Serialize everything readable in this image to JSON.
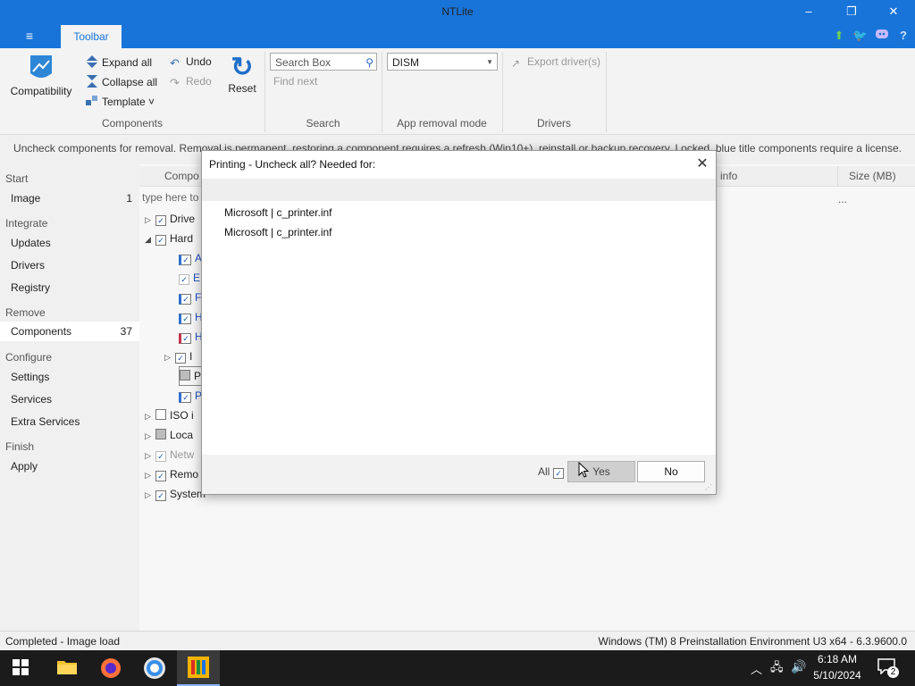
{
  "window": {
    "title": "NTLite",
    "menu_icon": "hamburger-menu-icon",
    "tab": "Toolbar",
    "minimize": "–",
    "restore": "❐",
    "close": "✕"
  },
  "ribbon": {
    "compatibility": "Compatibility",
    "expand_all": "Expand all",
    "collapse_all": "Collapse all",
    "template": "Template ˅",
    "undo": "Undo",
    "redo": "Redo",
    "reset": "Reset",
    "search_placeholder": "Search Box",
    "find_next": "Find next",
    "dism_value": "DISM",
    "export_drivers": "Export driver(s)",
    "groups": {
      "components": "Components",
      "search": "Search",
      "app_removal": "App removal mode",
      "drivers": "Drivers"
    }
  },
  "info_text": "Uncheck components for removal. Removal is permanent, restoring a component requires a refresh (Win10+), reinstall or backup recovery. Locked, blue title components require a license.",
  "sidebar": {
    "start": "Start",
    "image": {
      "label": "Image",
      "count": "1"
    },
    "integrate": "Integrate",
    "updates": "Updates",
    "drivers": "Drivers",
    "registry": "Registry",
    "remove": "Remove",
    "components": {
      "label": "Components",
      "count": "37"
    },
    "configure": "Configure",
    "settings": "Settings",
    "services": "Services",
    "extra_services": "Extra Services",
    "finish": "Finish",
    "apply": "Apply"
  },
  "list": {
    "col_component": "Compo",
    "col_info": "info",
    "col_size": "Size (MB)",
    "filter_placeholder": "type here to",
    "ellipsis": "...",
    "rows": {
      "driver": "Drive",
      "hard": "Hard",
      "r_a": "A",
      "r_e": "E",
      "r_f": "F",
      "r_h1": "H",
      "r_h2": "H",
      "r_i": "I",
      "r_p": "P",
      "r_p2": "P",
      "iso": "ISO i",
      "local": "Loca",
      "netw": "Netw",
      "remo": "Remo",
      "system": "System"
    }
  },
  "dialog": {
    "title": "Printing - Uncheck all? Needed for:",
    "lines": [
      "Microsoft  |  c_printer.inf",
      "Microsoft  |  c_printer.inf"
    ],
    "all_label": "All",
    "yes": "Yes",
    "no": "No"
  },
  "status": {
    "left": "Completed - Image load",
    "right": "Windows (TM) 8 Preinstallation Environment U3 x64 - 6.3.9600.0"
  },
  "taskbar": {
    "time": "6:18 AM",
    "date": "5/10/2024",
    "notification_count": "2"
  },
  "colors": {
    "accent": "#1874d8",
    "taskbar": "#1b1b1b"
  }
}
